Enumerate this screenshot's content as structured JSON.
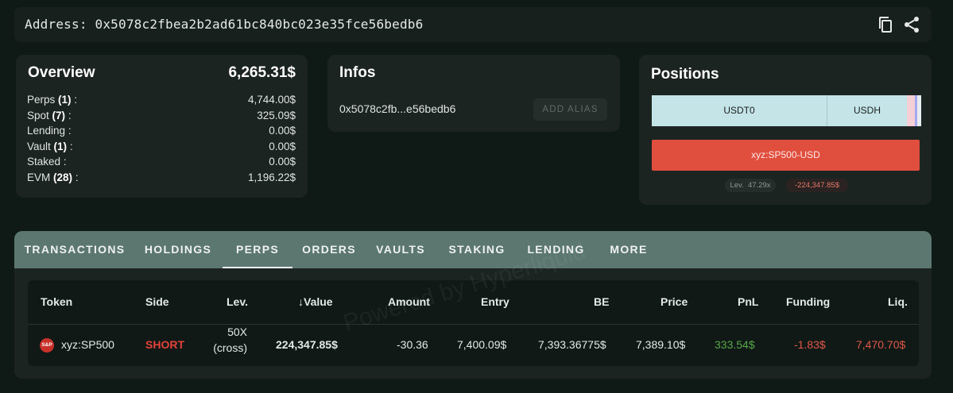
{
  "header": {
    "address_label": "Address: 0x5078c2fbea2b2ad61bc840bc023e35fce56bedb6",
    "copy_icon": "copy-icon",
    "share_icon": "share-icon"
  },
  "overview": {
    "title": "Overview",
    "total": "6,265.31$",
    "rows": [
      {
        "label": "Perps",
        "count": "(1)",
        "suffix": ":",
        "value": "4,744.00$"
      },
      {
        "label": "Spot",
        "count": "(7)",
        "suffix": ":",
        "value": "325.09$"
      },
      {
        "label": "Lending",
        "count": "",
        "suffix": ":",
        "value": "0.00$"
      },
      {
        "label": "Vault",
        "count": "(1)",
        "suffix": ":",
        "value": "0.00$"
      },
      {
        "label": "Staked",
        "count": "",
        "suffix": ":",
        "value": "0.00$"
      },
      {
        "label": "EVM",
        "count": "(28)",
        "suffix": ":",
        "value": "1,196.22$"
      }
    ]
  },
  "infos": {
    "title": "Infos",
    "short_address": "0x5078c2fb...e56bedb6",
    "add_alias_label": "ADD ALIAS"
  },
  "positions": {
    "title": "Positions",
    "spot_segments": [
      {
        "label": "USDT0",
        "color": "#c4e4e8",
        "share": 0.649
      },
      {
        "label": "USDH",
        "color": "#c4e4e8",
        "share": 0.299
      },
      {
        "label": "",
        "color": "#f4cfd6",
        "share": 0.029
      },
      {
        "label": "",
        "color": "#a7a8f0",
        "share": 0.009
      },
      {
        "label": "",
        "color": "#e8eef0",
        "share": 0.014
      }
    ],
    "perp_bar": {
      "label": "xyz:SP500-USD",
      "color": "#e04e3e"
    },
    "leverage_label": "Lev.",
    "leverage_value": "47.29x",
    "pnl_value": "-224,347.85$"
  },
  "tabs": {
    "items": [
      "TRANSACTIONS",
      "HOLDINGS",
      "PERPS",
      "ORDERS",
      "VAULTS",
      "STAKING",
      "LENDING",
      "MORE"
    ],
    "active": "PERPS"
  },
  "perps_table": {
    "columns": [
      "Token",
      "Side",
      "Lev.",
      "Value",
      "Amount",
      "Entry",
      "BE",
      "Price",
      "PnL",
      "Funding",
      "Liq."
    ],
    "sort_icon": "arrow-down-icon",
    "row": {
      "token_logo_text": "S&P",
      "token": "xyz:SP500",
      "side": "SHORT",
      "lev_line1": "50X",
      "lev_line2": "(cross)",
      "value": "224,347.85$",
      "amount": "-30.36",
      "entry": "7,400.09$",
      "be": "7,393.36775$",
      "price": "7,389.10$",
      "pnl": "333.54$",
      "funding": "-1.83$",
      "liq": "7,470.70$"
    },
    "colors": {
      "short": "#e3423a",
      "pnl_positive": "#57a64a",
      "negative": "#e0564a"
    }
  },
  "watermark": "Powered by Hyperliquid"
}
